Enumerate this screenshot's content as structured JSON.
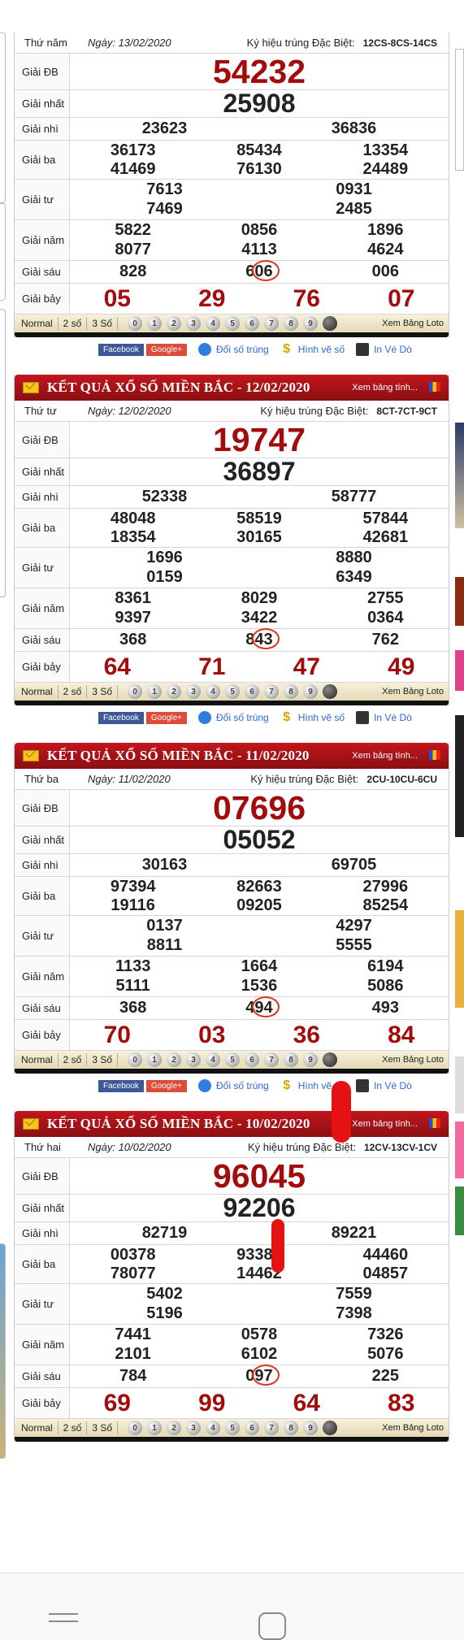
{
  "share": {
    "facebook": "Facebook",
    "google": "Google+",
    "doi_so": "Đổi số trúng",
    "hinh_ve": "Hình vẽ số",
    "in_ve": "In Vé Dò"
  },
  "toolbar": {
    "modes": [
      "Normal",
      "2 số",
      "3 Số"
    ],
    "balls": [
      "0",
      "1",
      "2",
      "3",
      "4",
      "5",
      "6",
      "7",
      "8",
      "9"
    ],
    "xem_loto": "Xem Bảng Loto"
  },
  "labels": {
    "db": "Giải ĐB",
    "g1": "Giải nhất",
    "g2": "Giải nhì",
    "g3": "Giải ba",
    "g4": "Giải tư",
    "g5": "Giải năm",
    "g6": "Giải sáu",
    "g7": "Giải bảy",
    "kyhieu": "Ký hiệu trúng Đặc Biệt:",
    "bang": "Xem bảng tính..."
  },
  "results": [
    {
      "header": "",
      "weekday": "Thứ năm",
      "date": "Ngày: 13/02/2020",
      "code": "12CS-8CS-14CS",
      "db": "54232",
      "g1": "25908",
      "g2": [
        "23623",
        "36836"
      ],
      "g3": [
        "36173",
        "85434",
        "13354",
        "41469",
        "76130",
        "24489"
      ],
      "g4": [
        "7613",
        "0931",
        "7469",
        "2485"
      ],
      "g5": [
        "5822",
        "0856",
        "1896",
        "8077",
        "4113",
        "4624"
      ],
      "g6": [
        "828",
        "606",
        "006"
      ],
      "g7": [
        "05",
        "29",
        "76",
        "07"
      ]
    },
    {
      "header": "KẾT QUẢ XỔ SỐ MIỀN BẮC - 12/02/2020",
      "weekday": "Thứ tư",
      "date": "Ngày: 12/02/2020",
      "code": "8CT-7CT-9CT",
      "db": "19747",
      "g1": "36897",
      "g2": [
        "52338",
        "58777"
      ],
      "g3": [
        "48048",
        "58519",
        "57844",
        "18354",
        "30165",
        "42681"
      ],
      "g4": [
        "1696",
        "8880",
        "0159",
        "6349"
      ],
      "g5": [
        "8361",
        "8029",
        "2755",
        "9397",
        "3422",
        "0364"
      ],
      "g6": [
        "368",
        "843",
        "762"
      ],
      "g7": [
        "64",
        "71",
        "47",
        "49"
      ]
    },
    {
      "header": "KẾT QUẢ XỔ SỐ MIỀN BẮC - 11/02/2020",
      "weekday": "Thứ ba",
      "date": "Ngày: 11/02/2020",
      "code": "2CU-10CU-6CU",
      "db": "07696",
      "g1": "05052",
      "g2": [
        "30163",
        "69705"
      ],
      "g3": [
        "97394",
        "82663",
        "27996",
        "19116",
        "09205",
        "85254"
      ],
      "g4": [
        "0137",
        "4297",
        "8811",
        "5555"
      ],
      "g5": [
        "1133",
        "1664",
        "6194",
        "5111",
        "1536",
        "5086"
      ],
      "g6": [
        "368",
        "494",
        "493"
      ],
      "g7": [
        "70",
        "03",
        "36",
        "84"
      ]
    },
    {
      "header": "KẾT QUẢ XỔ SỐ MIỀN BẮC - 10/02/2020",
      "weekday": "Thứ hai",
      "date": "Ngày: 10/02/2020",
      "code": "12CV-13CV-1CV",
      "db": "96045",
      "g1": "92206",
      "g2": [
        "82719",
        "89221"
      ],
      "g3": [
        "00378",
        "93384",
        "44460",
        "78077",
        "14462",
        "04857"
      ],
      "g4": [
        "5402",
        "7559",
        "5196",
        "7398"
      ],
      "g5": [
        "7441",
        "0578",
        "7326",
        "2101",
        "6102",
        "5076"
      ],
      "g6": [
        "784",
        "097",
        "225"
      ],
      "g7": [
        "69",
        "99",
        "64",
        "83"
      ]
    }
  ],
  "colors": {
    "header_red": "#b0141a",
    "prize_red": "#a30c0c",
    "toolbar_beige": "#efe6c8",
    "link_blue": "#2a6ad1"
  },
  "navbar": {
    "menu_icon": "menu-icon",
    "home_icon": "home-icon"
  }
}
